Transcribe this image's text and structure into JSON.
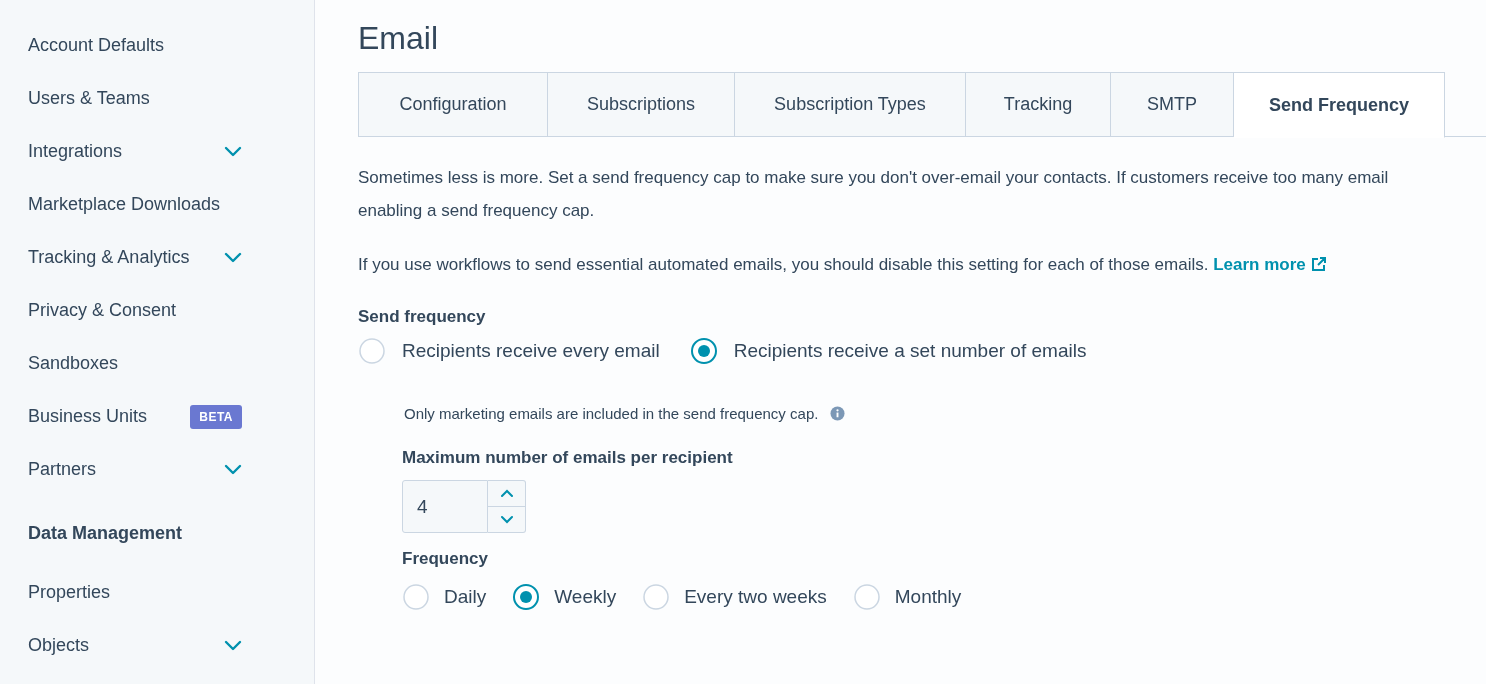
{
  "sidebar": {
    "items": [
      {
        "label": "Account Defaults",
        "kind": "link",
        "expandable": false
      },
      {
        "label": "Users & Teams",
        "kind": "link",
        "expandable": false
      },
      {
        "label": "Integrations",
        "kind": "link",
        "expandable": true
      },
      {
        "label": "Marketplace Downloads",
        "kind": "link",
        "expandable": false
      },
      {
        "label": "Tracking & Analytics",
        "kind": "link",
        "expandable": true
      },
      {
        "label": "Privacy & Consent",
        "kind": "link",
        "expandable": false
      },
      {
        "label": "Sandboxes",
        "kind": "link",
        "expandable": false
      },
      {
        "label": "Business Units",
        "kind": "link",
        "expandable": false,
        "badge": "BETA"
      },
      {
        "label": "Partners",
        "kind": "link",
        "expandable": true
      },
      {
        "label": "Data Management",
        "kind": "heading",
        "expandable": false
      },
      {
        "label": "Properties",
        "kind": "link",
        "expandable": false
      },
      {
        "label": "Objects",
        "kind": "link",
        "expandable": true
      }
    ]
  },
  "page_title": "Email",
  "tabs": [
    {
      "label": "Configuration",
      "selected": false
    },
    {
      "label": "Subscriptions",
      "selected": false
    },
    {
      "label": "Subscription Types",
      "selected": false
    },
    {
      "label": "Tracking",
      "selected": false
    },
    {
      "label": "SMTP",
      "selected": false
    },
    {
      "label": "Send Frequency",
      "selected": true
    }
  ],
  "intro_lines": [
    "Sometimes less is more. Set a send frequency cap to make sure you don't over-email your contacts. If customers receive too many email",
    "enabling a send frequency cap."
  ],
  "workflow_note": {
    "text": "If you use workflows to send essential automated emails, you should disable this setting for each of those emails.",
    "link": "Learn more"
  },
  "send_frequency": {
    "label": "Send frequency",
    "options": [
      {
        "label": "Recipients receive every email",
        "selected": false
      },
      {
        "label": "Recipients receive a set number of emails",
        "selected": true
      }
    ]
  },
  "cap_note": "Only marketing emails are included in the send frequency cap.",
  "max_emails": {
    "label": "Maximum number of emails per recipient",
    "value": "4"
  },
  "frequency": {
    "label": "Frequency",
    "options": [
      {
        "label": "Daily",
        "selected": false
      },
      {
        "label": "Weekly",
        "selected": true
      },
      {
        "label": "Every two weeks",
        "selected": false
      },
      {
        "label": "Monthly",
        "selected": false
      }
    ]
  }
}
